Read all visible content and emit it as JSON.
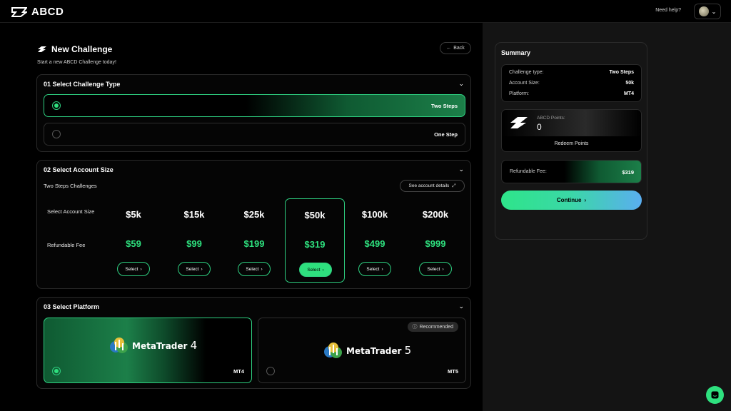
{
  "header": {
    "brand": "ABCD",
    "help_label": "Need help?"
  },
  "page": {
    "title": "New Challenge",
    "subtitle": "Start a new ABCD Challenge today!",
    "back_label": "Back"
  },
  "challenge_type": {
    "heading": "01 Select Challenge Type",
    "options": [
      {
        "label": "Two Steps",
        "selected": true
      },
      {
        "label": "One Step",
        "selected": false
      }
    ]
  },
  "account_size": {
    "heading": "02 Select Account Size",
    "subheading": "Two Steps Challenges",
    "details_label": "See account details",
    "row_label_size": "Select Account Size",
    "row_label_fee": "Refundable Fee",
    "select_label": "Select",
    "sizes": [
      {
        "size": "$5k",
        "fee": "$59",
        "selected": false
      },
      {
        "size": "$15k",
        "fee": "$99",
        "selected": false
      },
      {
        "size": "$25k",
        "fee": "$199",
        "selected": false
      },
      {
        "size": "$50k",
        "fee": "$319",
        "selected": true
      },
      {
        "size": "$100k",
        "fee": "$499",
        "selected": false
      },
      {
        "size": "$200k",
        "fee": "$999",
        "selected": false
      }
    ]
  },
  "platform": {
    "heading": "03 Select Platform",
    "recommended_label": "Recommended",
    "options": [
      {
        "name": "MetaTrader",
        "version": "4",
        "code": "MT4",
        "selected": true
      },
      {
        "name": "MetaTrader",
        "version": "5",
        "code": "MT5",
        "selected": false
      }
    ]
  },
  "summary": {
    "title": "Summary",
    "rows": [
      {
        "key": "Challenge type:",
        "value": "Two Steps"
      },
      {
        "key": "Account Size:",
        "value": "50k"
      },
      {
        "key": "Platform:",
        "value": "MT4"
      }
    ],
    "points_label": "ABCD Points:",
    "points_value": "0",
    "redeem_label": "Redeem Points",
    "fee_label": "Refundable Fee:",
    "fee_value": "$319",
    "continue_label": "Continue"
  },
  "colors": {
    "accent": "#2ee07e",
    "gradient_end": "#5aaef0",
    "background": "#000000",
    "panel": "#141414"
  }
}
